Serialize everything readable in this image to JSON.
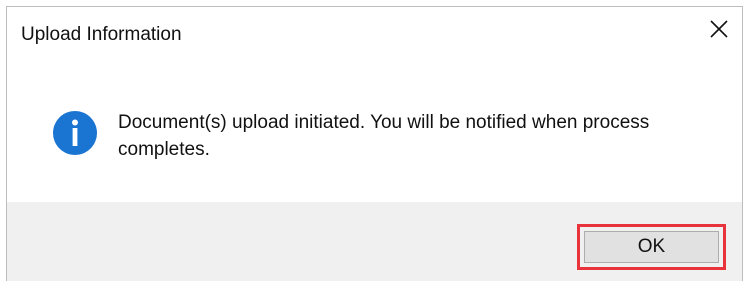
{
  "dialog": {
    "title": "Upload Information",
    "close_icon": "close-icon",
    "info_icon": "info-icon",
    "message": "Document(s) upload initiated. You will be notified when process completes.",
    "ok_label": "OK"
  },
  "colors": {
    "info_icon_fill": "#1a74d2",
    "footer_background": "#f0f0f0",
    "highlight_border": "#e8333d",
    "button_background": "#e1e1e1"
  }
}
